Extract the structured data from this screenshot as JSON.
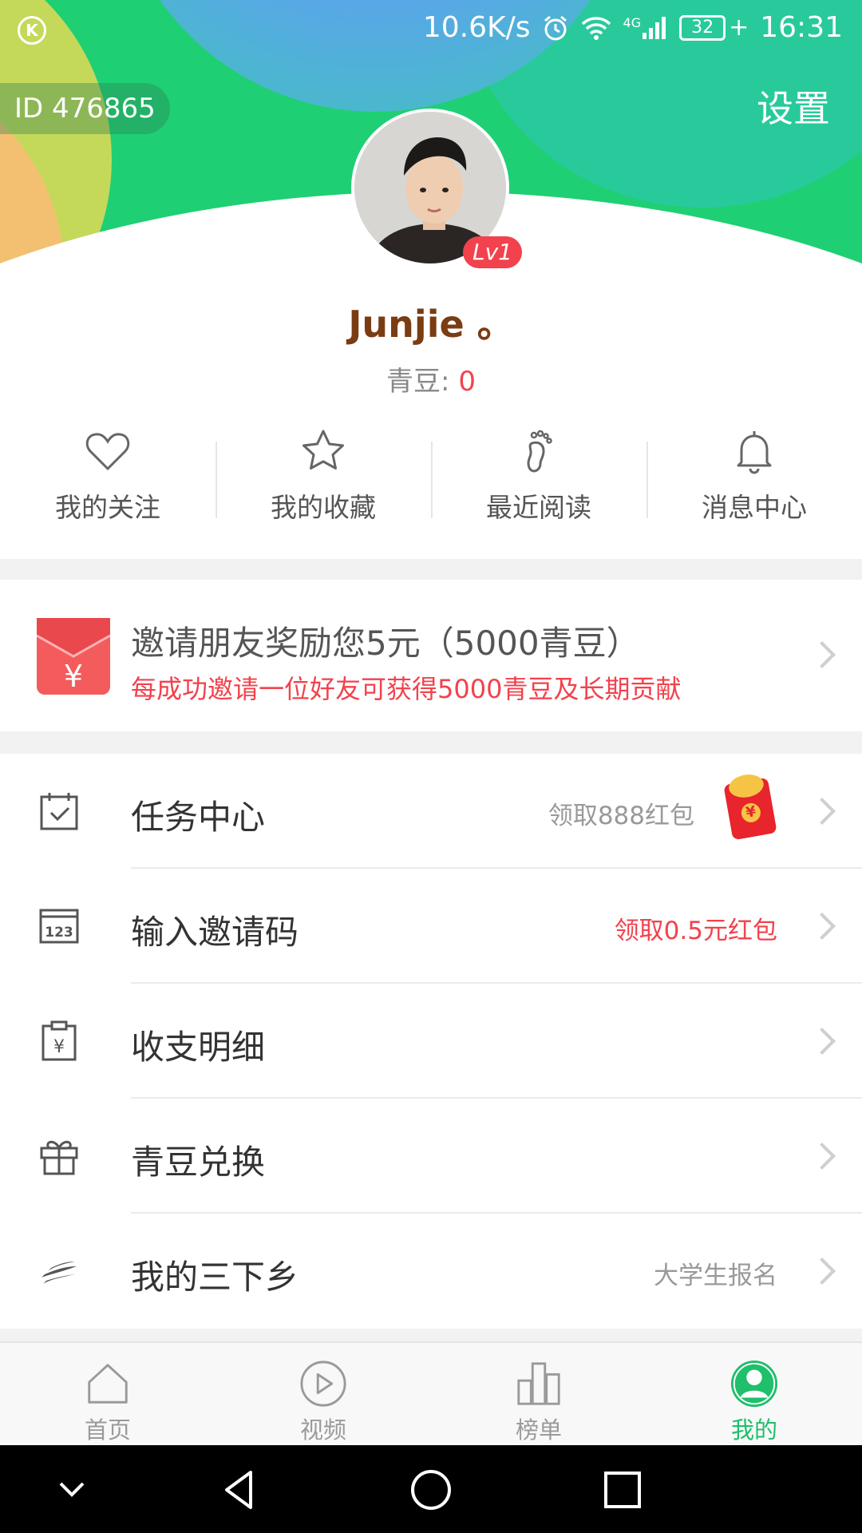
{
  "status_bar": {
    "app_icon": "K",
    "net_speed": "10.6K/s",
    "net_type": "4G",
    "battery": "32",
    "time": "16:31"
  },
  "profile": {
    "id_label": "ID 476865",
    "settings_label": "设置",
    "level": "Lv1",
    "username": "Junjie 。",
    "beans_label": "青豆:",
    "beans_value": "0"
  },
  "quick_actions": [
    {
      "label": "我的关注",
      "icon": "heart-icon"
    },
    {
      "label": "我的收藏",
      "icon": "star-icon"
    },
    {
      "label": "最近阅读",
      "icon": "footprint-icon"
    },
    {
      "label": "消息中心",
      "icon": "bell-icon"
    }
  ],
  "invite": {
    "title": "邀请朋友奖励您5元（5000青豆）",
    "subtitle": "每成功邀请一位好友可获得5000青豆及长期贡献",
    "icon": "red-envelope-icon"
  },
  "menu": [
    {
      "label": "任务中心",
      "right": "领取888红包",
      "icon": "calendar-check-icon"
    },
    {
      "label": "输入邀请码",
      "right": "领取0.5元红包",
      "icon": "code-123-icon"
    },
    {
      "label": "收支明细",
      "right": "",
      "icon": "yuan-clipboard-icon"
    },
    {
      "label": "青豆兑换",
      "right": "",
      "icon": "gift-icon"
    },
    {
      "label": "我的三下乡",
      "right": "大学生报名",
      "icon": "wing-icon"
    }
  ],
  "tabs": [
    {
      "label": "首页",
      "icon": "home-icon",
      "active": false
    },
    {
      "label": "视频",
      "icon": "play-icon",
      "active": false
    },
    {
      "label": "榜单",
      "icon": "ranking-icon",
      "active": false
    },
    {
      "label": "我的",
      "icon": "user-icon",
      "active": true
    }
  ],
  "colors": {
    "brand_green": "#1fcf73",
    "accent_red": "#f2424d",
    "username_brown": "#7a3c12"
  }
}
